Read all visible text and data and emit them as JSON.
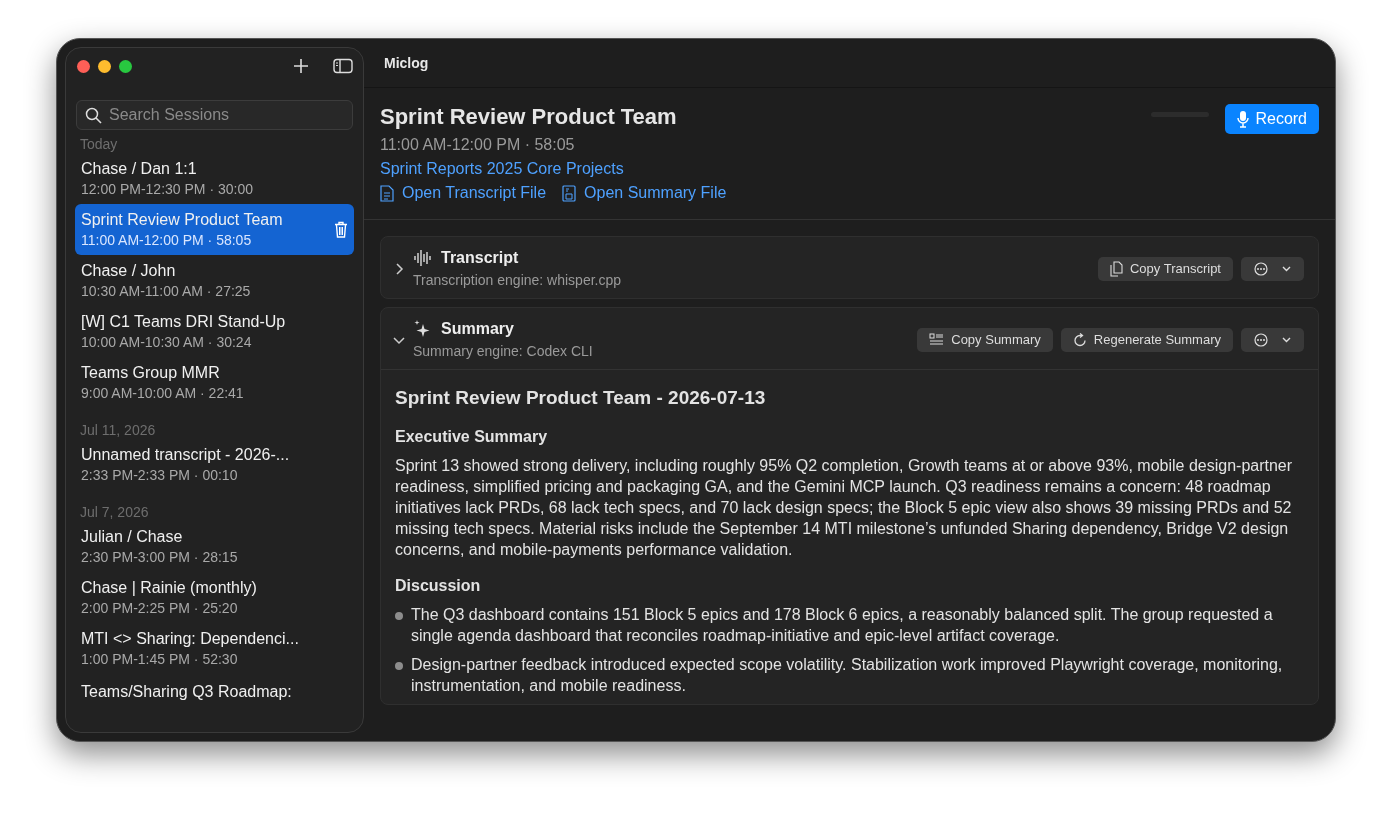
{
  "window": {
    "title": "Miclog"
  },
  "sidebar": {
    "search": {
      "placeholder": "Search Sessions"
    },
    "groups": [
      {
        "label": "Today",
        "sessions": [
          {
            "title": "Chase / Dan 1:1",
            "time": "12:00 PM-12:30 PM · 30:00",
            "selected": false
          },
          {
            "title": "Sprint Review Product Team",
            "time": "11:00 AM-12:00 PM · 58:05",
            "selected": true
          },
          {
            "title": "Chase / John",
            "time": "10:30 AM-11:00 AM · 27:25",
            "selected": false
          },
          {
            "title": "[W]  C1 Teams DRI Stand-Up",
            "time": "10:00 AM-10:30 AM · 30:24",
            "selected": false
          },
          {
            "title": "Teams Group MMR",
            "time": "9:00 AM-10:00 AM · 22:41",
            "selected": false
          }
        ]
      },
      {
        "label": "Jul 11, 2026",
        "sessions": [
          {
            "title": "Unnamed transcript - 2026-...",
            "time": "2:33 PM-2:33 PM · 00:10",
            "selected": false
          }
        ]
      },
      {
        "label": "Jul 7, 2026",
        "sessions": [
          {
            "title": "Julian / Chase",
            "time": "2:30 PM-3:00 PM · 28:15",
            "selected": false
          },
          {
            "title": "Chase | Rainie (monthly)",
            "time": "2:00 PM-2:25 PM · 25:20",
            "selected": false
          },
          {
            "title": "MTI <> Sharing: Dependenci...",
            "time": "1:00 PM-1:45 PM · 52:30",
            "selected": false
          },
          {
            "title": "Teams/Sharing Q3 Roadmap:",
            "selected": false
          }
        ]
      }
    ]
  },
  "session": {
    "title": "Sprint Review Product Team",
    "time": "11:00 AM-12:00 PM · 58:05",
    "project": "Sprint Reports 2025 Core Projects",
    "file_links": [
      {
        "kind": "transcript",
        "label": "Open Transcript File"
      },
      {
        "kind": "summary",
        "label": "Open Summary File"
      }
    ],
    "record_button": "Record"
  },
  "sections": [
    {
      "kind": "transcript",
      "title": "Transcript",
      "engine": "Transcription engine: whisper.cpp",
      "expanded": false,
      "actions": [
        {
          "kind": "copy",
          "label": "Copy Transcript"
        },
        {
          "kind": "menu"
        }
      ]
    },
    {
      "kind": "summary",
      "title": "Summary",
      "engine": "Summary engine: Codex CLI",
      "expanded": true,
      "actions": [
        {
          "kind": "copy-summary",
          "label": "Copy Summary"
        },
        {
          "kind": "regenerate",
          "label": "Regenerate Summary"
        },
        {
          "kind": "menu"
        }
      ],
      "content": {
        "heading": "Sprint Review Product Team - 2026-07-13",
        "blocks": [
          {
            "heading": "Executive Summary",
            "paragraph": "Sprint 13 showed strong delivery, including roughly 95% Q2 completion, Growth teams at or above 93%, mobile design-partner readiness, simplified pricing and packaging GA, and the Gemini MCP launch. Q3 readiness remains a concern: 48 roadmap initiatives lack PRDs, 68 lack tech specs, and 70 lack design specs; the Block 5 epic view also shows 39 missing PRDs and 52 missing tech specs. Material risks include the September 14 MTI milestone’s unfunded Sharing dependency, Bridge V2 design concerns, and mobile-payments performance validation."
          },
          {
            "heading": "Discussion",
            "bullets": [
              "The Q3 dashboard contains 151 Block 5 epics and 178 Block 6 epics, a reasonably balanced split. The group requested a single agenda dashboard that reconciles roadmap-initiative and epic-level artifact coverage.",
              "Design-partner feedback introduced expected scope volatility. Stabilization work improved Playwright coverage, monitoring, instrumentation, and mobile readiness."
            ]
          }
        ]
      }
    }
  ]
}
